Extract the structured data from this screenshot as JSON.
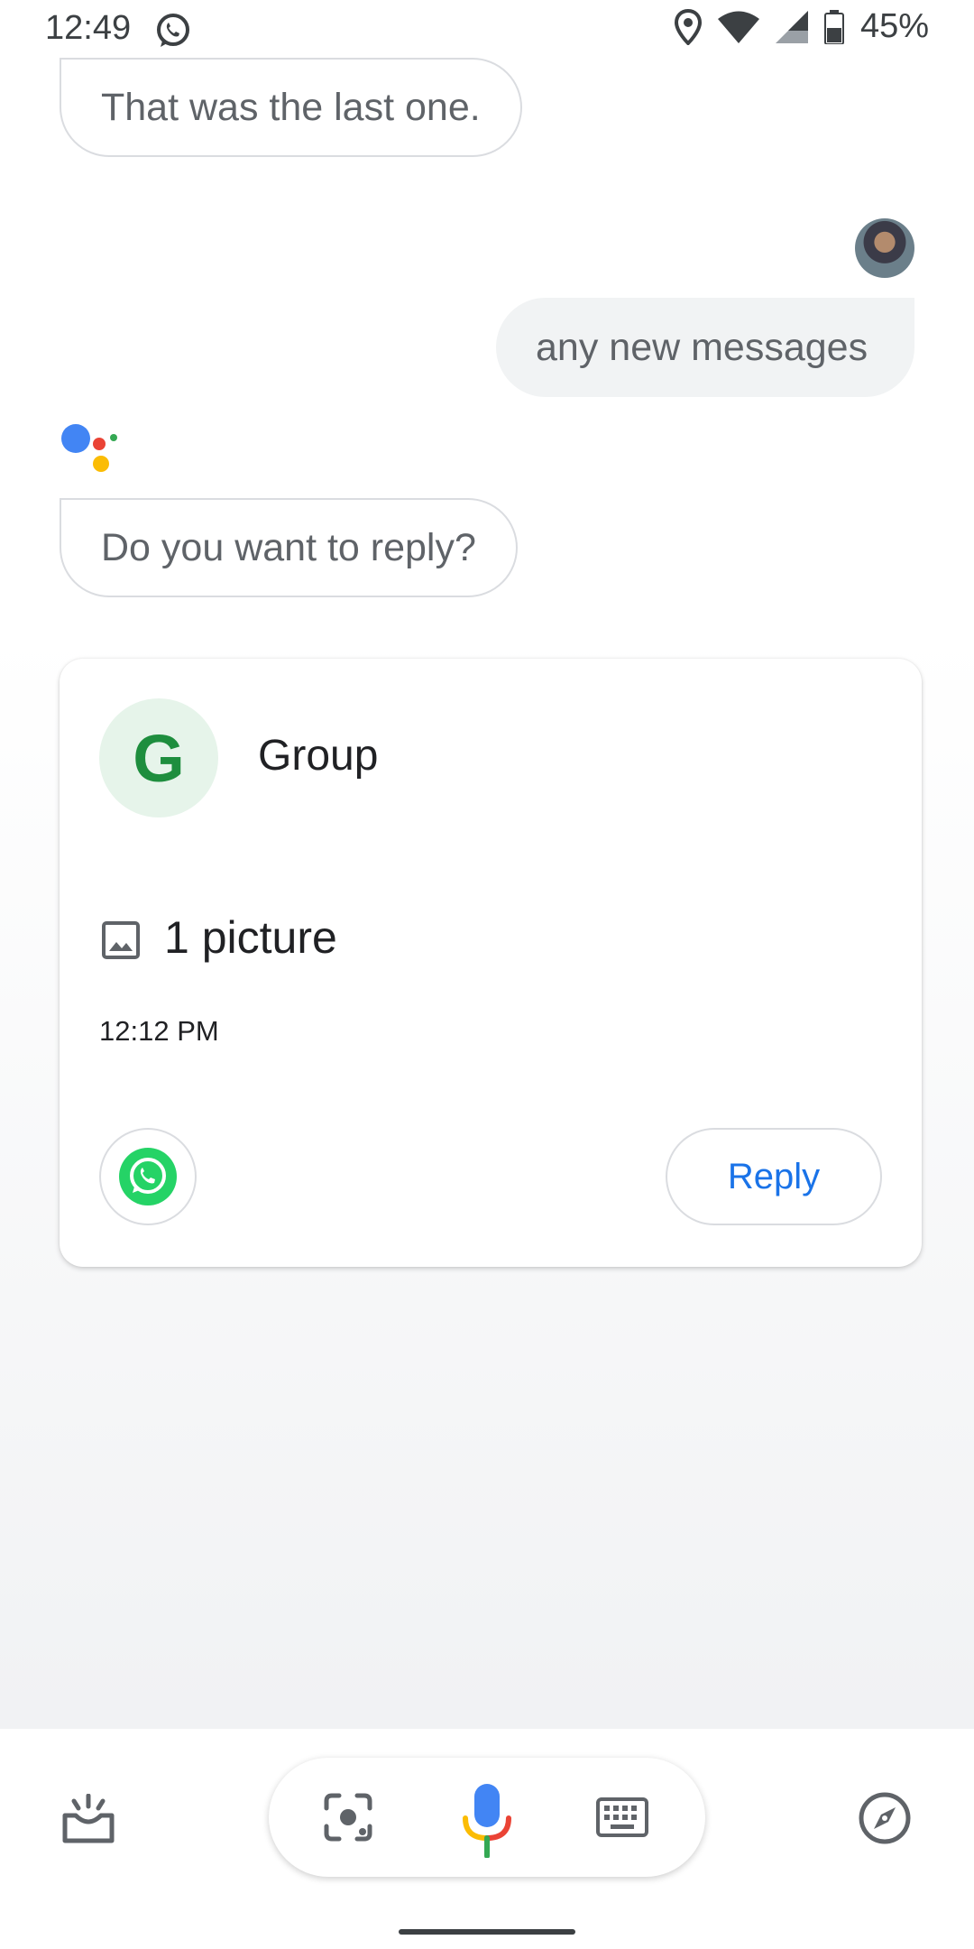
{
  "status_bar": {
    "time": "12:49",
    "notification_icon": "whatsapp-icon",
    "icons": [
      "location-icon",
      "wifi-icon",
      "cell-signal-icon",
      "battery-icon"
    ],
    "battery": "45%"
  },
  "conversation": {
    "assistant_message_1": "That was the last one.",
    "user_message": "any new messages",
    "assistant_message_2": "Do you want to reply?"
  },
  "card": {
    "avatar_letter": "G",
    "title": "Group",
    "message_icon": "image-icon",
    "message": "1 picture",
    "time": "12:12 PM",
    "app_icon": "whatsapp-icon",
    "reply_label": "Reply"
  },
  "bottom_bar": {
    "icons": [
      "updates-icon",
      "lens-icon",
      "mic-icon",
      "keyboard-icon",
      "explore-icon"
    ]
  },
  "colors": {
    "accent": "#1a73e8",
    "group_avatar_bg": "#e6f4ea",
    "group_avatar_fg": "#1e8e3e",
    "whatsapp": "#25d366"
  }
}
